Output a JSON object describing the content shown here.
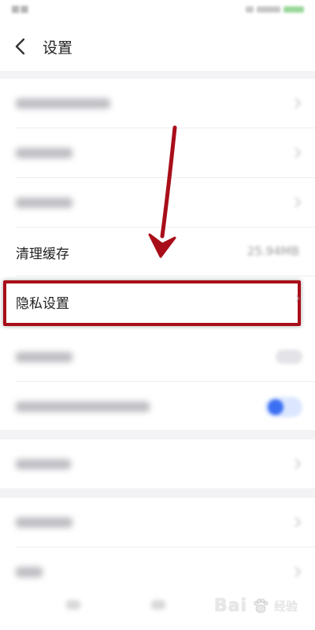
{
  "header": {
    "title": "设置"
  },
  "settings": {
    "clear_cache": {
      "label": "清理缓存",
      "value": "25.94MB"
    },
    "privacy": {
      "label": "隐私设置"
    }
  },
  "icons": {
    "back": "chevron-left-icon",
    "row_arrow": "chevron-right-icon",
    "annotation": "red-arrow-icon",
    "watermark_paw": "baidu-paw-icon"
  },
  "watermark": {
    "logo": "Bai",
    "suffix": "经验"
  },
  "colors": {
    "highlight": "#a80e19",
    "arrow": "#a80e19",
    "toggle_on": "#3a6ff2",
    "background": "#f3f3f6"
  }
}
